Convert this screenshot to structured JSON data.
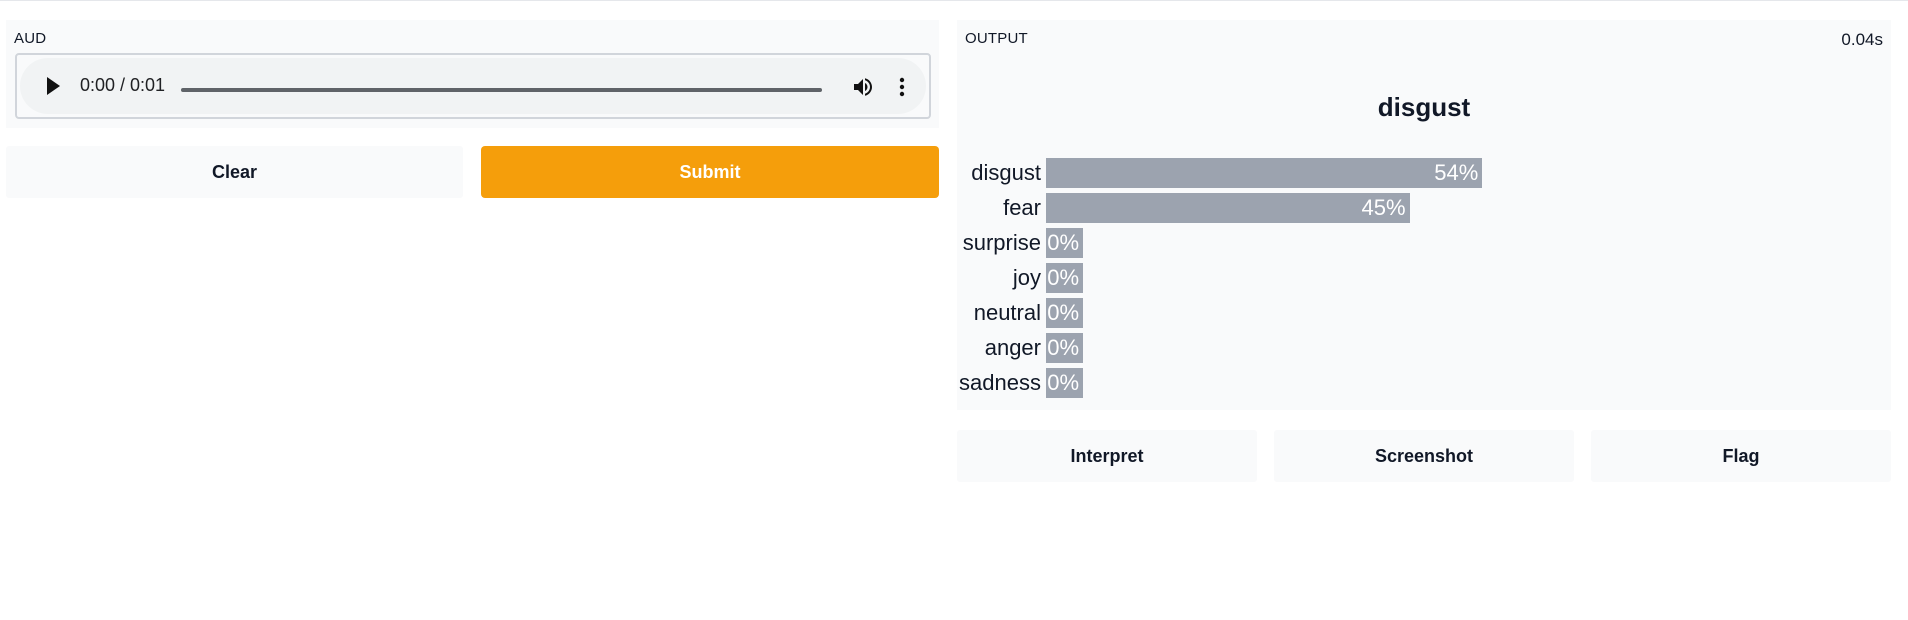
{
  "input": {
    "label": "AUD",
    "audio": {
      "time_display": "0:00 / 0:01",
      "play_icon": "play-icon",
      "volume_icon": "volume-icon",
      "more_icon": "more-vertical-icon"
    }
  },
  "actions": {
    "clear_label": "Clear",
    "submit_label": "Submit"
  },
  "output": {
    "label": "OUTPUT",
    "timing": "0.04s",
    "top_label": "disgust"
  },
  "output_actions": {
    "interpret_label": "Interpret",
    "screenshot_label": "Screenshot",
    "flag_label": "Flag"
  },
  "colors": {
    "accent": "#f59e0b",
    "bar": "#9ca3af",
    "panel": "#f9fafb"
  },
  "chart_data": {
    "type": "bar",
    "orientation": "horizontal",
    "categories": [
      "disgust",
      "fear",
      "surprise",
      "joy",
      "neutral",
      "anger",
      "sadness"
    ],
    "values": [
      54,
      45,
      0,
      0,
      0,
      0,
      0
    ],
    "value_labels": [
      "54%",
      "45%",
      "0%",
      "0%",
      "0%",
      "0%",
      "0%"
    ]
  }
}
